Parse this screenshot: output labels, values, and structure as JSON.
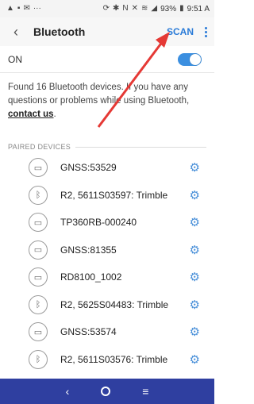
{
  "status_bar": {
    "time": "9:51 A",
    "battery": "93%"
  },
  "header": {
    "back_icon": "chevron-left-icon",
    "title": "Bluetooth",
    "scan_label": "SCAN",
    "more_icon": "more-vert-icon"
  },
  "toggle": {
    "label": "ON",
    "state": "on"
  },
  "info": {
    "text_before_link": "Found 16 Bluetooth devices. If you have any questions or problems while using Bluetooth, ",
    "link_text": "contact us",
    "text_after_link": "."
  },
  "section": {
    "paired_title": "PAIRED DEVICES"
  },
  "devices": [
    {
      "name": "GNSS:53529",
      "icon": "device-icon"
    },
    {
      "name": "R2, 5611S03597: Trimble",
      "icon": "bluetooth-icon"
    },
    {
      "name": "TP360RB-000240",
      "icon": "device-icon"
    },
    {
      "name": "GNSS:81355",
      "icon": "device-icon"
    },
    {
      "name": "RD8100_1002",
      "icon": "device-icon"
    },
    {
      "name": "R2, 5625S04483: Trimble",
      "icon": "bluetooth-icon"
    },
    {
      "name": "GNSS:53574",
      "icon": "device-icon"
    },
    {
      "name": "R2, 5611S03576: Trimble",
      "icon": "bluetooth-icon"
    }
  ],
  "colors": {
    "accent": "#2a7bd8",
    "nav_bar": "#2f3fa0",
    "arrow": "#e53935"
  }
}
